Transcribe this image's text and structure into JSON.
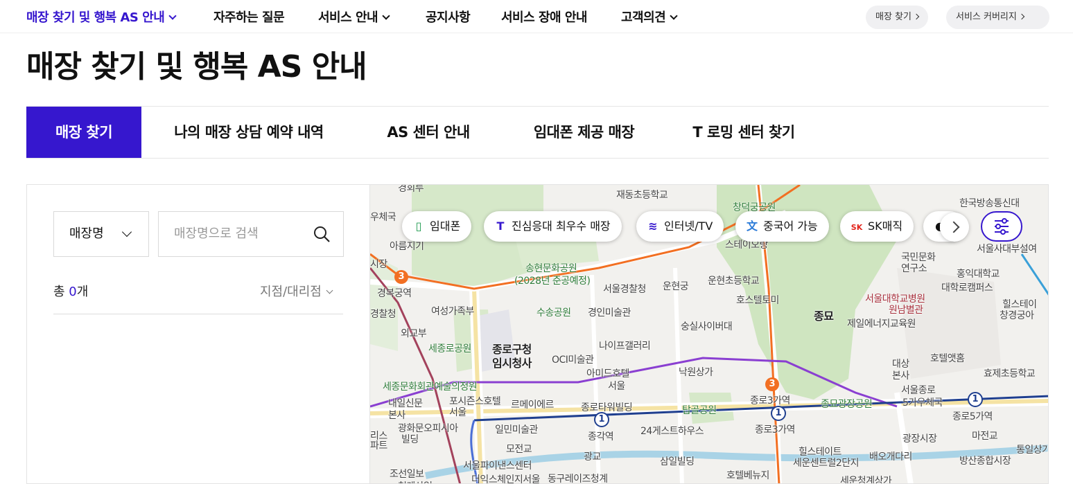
{
  "nav": {
    "items": [
      {
        "label": "매장 찾기 및 행복 AS 안내",
        "active": true,
        "has_dropdown": true
      },
      {
        "label": "자주하는 질문",
        "active": false,
        "has_dropdown": false
      },
      {
        "label": "서비스 안내",
        "active": false,
        "has_dropdown": true
      },
      {
        "label": "공지사항",
        "active": false,
        "has_dropdown": false
      },
      {
        "label": "서비스 장애 안내",
        "active": false,
        "has_dropdown": false
      },
      {
        "label": "고객의견",
        "active": false,
        "has_dropdown": true
      }
    ],
    "quick_links": [
      {
        "label": "매장 찾기"
      },
      {
        "label": "서비스 커버리지"
      }
    ]
  },
  "page_title": "매장 찾기 및 행복 AS 안내",
  "tabs": [
    {
      "label": "매장 찾기",
      "active": true
    },
    {
      "label": "나의 매장 상담 예약 내역",
      "active": false
    },
    {
      "label": "AS 센터 안내",
      "active": false
    },
    {
      "label": "임대폰 제공 매장",
      "active": false
    },
    {
      "label": "T 로밍 센터 찾기",
      "active": false
    }
  ],
  "search": {
    "select_value": "매장명",
    "placeholder": "매장명으로 검색"
  },
  "result": {
    "prefix": "총 ",
    "count": "0",
    "suffix": "개",
    "sort_label": "지점/대리점"
  },
  "map": {
    "chips": [
      {
        "label": "임대폰",
        "icon": "phone-icon"
      },
      {
        "label": "진심응대 최우수 매장",
        "icon": "t-logo-icon"
      },
      {
        "label": "인터넷/TV",
        "icon": "router-icon"
      },
      {
        "label": "중국어 가능",
        "icon": "chinese-char-icon"
      },
      {
        "label": "SK매직",
        "icon": "sk-logo-icon"
      }
    ],
    "labels": [
      {
        "text": "경회루",
        "cls": ""
      },
      {
        "text": "재동초등학교",
        "cls": ""
      },
      {
        "text": "창덕궁공원",
        "cls": "green"
      },
      {
        "text": "한국방송통신대",
        "cls": ""
      },
      {
        "text": "우체국",
        "cls": ""
      },
      {
        "text": "아름지기",
        "cls": ""
      },
      {
        "text": "시장",
        "cls": ""
      },
      {
        "text": "스테이오랑",
        "cls": ""
      },
      {
        "text": "송현문화공원",
        "cls": "green"
      },
      {
        "text": "(2028년 준공예정)",
        "cls": "green"
      },
      {
        "text": "서울경찰청",
        "cls": ""
      },
      {
        "text": "운현궁",
        "cls": ""
      },
      {
        "text": "운현초등학교",
        "cls": ""
      },
      {
        "text": "국민문화",
        "cls": ""
      },
      {
        "text": "연구소",
        "cls": ""
      },
      {
        "text": "홍익대학교",
        "cls": ""
      },
      {
        "text": "대학로캠퍼스",
        "cls": ""
      },
      {
        "text": "서울사대부설여",
        "cls": ""
      },
      {
        "text": "경복궁역",
        "cls": ""
      },
      {
        "text": "여성가족부",
        "cls": ""
      },
      {
        "text": "수송공원",
        "cls": "green"
      },
      {
        "text": "경인미술관",
        "cls": ""
      },
      {
        "text": "호스텔토미",
        "cls": ""
      },
      {
        "text": "종묘",
        "cls": "big"
      },
      {
        "text": "서울대학교병원",
        "cls": "red"
      },
      {
        "text": "원남별관",
        "cls": "red"
      },
      {
        "text": "힐스테이",
        "cls": ""
      },
      {
        "text": "창경궁아",
        "cls": ""
      },
      {
        "text": "경찰청",
        "cls": ""
      },
      {
        "text": "숭실사이버대",
        "cls": ""
      },
      {
        "text": "제일에너지교육원",
        "cls": ""
      },
      {
        "text": "외교부",
        "cls": ""
      },
      {
        "text": "세종로공원",
        "cls": "green"
      },
      {
        "text": "종로구청",
        "cls": "big"
      },
      {
        "text": "임시청사",
        "cls": "big"
      },
      {
        "text": "나이프갤러리",
        "cls": ""
      },
      {
        "text": "OCI미술관",
        "cls": ""
      },
      {
        "text": "아미드호텔",
        "cls": ""
      },
      {
        "text": "서울",
        "cls": ""
      },
      {
        "text": "낙원상가",
        "cls": ""
      },
      {
        "text": "대상",
        "cls": ""
      },
      {
        "text": "본사",
        "cls": ""
      },
      {
        "text": "호텔앳홈",
        "cls": ""
      },
      {
        "text": "효제초등학교",
        "cls": ""
      },
      {
        "text": "세종문화회관예술의정원",
        "cls": "green"
      },
      {
        "text": "내일신문",
        "cls": ""
      },
      {
        "text": "본사",
        "cls": ""
      },
      {
        "text": "포시즌스호텔",
        "cls": ""
      },
      {
        "text": "서울",
        "cls": ""
      },
      {
        "text": "르메이에르",
        "cls": ""
      },
      {
        "text": "종로타워빌딩",
        "cls": ""
      },
      {
        "text": "탑골공원",
        "cls": "green"
      },
      {
        "text": "종로3가역",
        "cls": ""
      },
      {
        "text": "종묘광장공원",
        "cls": "green"
      },
      {
        "text": "서울종로",
        "cls": ""
      },
      {
        "text": "5가우체국",
        "cls": ""
      },
      {
        "text": "종로5가역",
        "cls": ""
      },
      {
        "text": "광화문오피시아",
        "cls": ""
      },
      {
        "text": "빌딩",
        "cls": ""
      },
      {
        "text": "일민미술관",
        "cls": ""
      },
      {
        "text": "종각역",
        "cls": ""
      },
      {
        "text": "24게스트하우스",
        "cls": ""
      },
      {
        "text": "종로3가역",
        "cls": ""
      },
      {
        "text": "광장시장",
        "cls": ""
      },
      {
        "text": "마전교",
        "cls": ""
      },
      {
        "text": "통일상가",
        "cls": ""
      },
      {
        "text": "리스",
        "cls": ""
      },
      {
        "text": "파트",
        "cls": ""
      },
      {
        "text": "모전교",
        "cls": ""
      },
      {
        "text": "광교",
        "cls": ""
      },
      {
        "text": "힐스테이트",
        "cls": ""
      },
      {
        "text": "세운센트럴2단지",
        "cls": ""
      },
      {
        "text": "배오개다리",
        "cls": ""
      },
      {
        "text": "방산종합시장",
        "cls": ""
      },
      {
        "text": "조선일보",
        "cls": ""
      },
      {
        "text": "서울파이낸스센터",
        "cls": ""
      },
      {
        "text": "삼일빌딩",
        "cls": ""
      },
      {
        "text": "호텔베뉴지",
        "cls": ""
      },
      {
        "text": "세운청계상가",
        "cls": ""
      },
      {
        "text": "청계산업",
        "cls": ""
      },
      {
        "text": "더익스체인지서울",
        "cls": ""
      },
      {
        "text": "동구레이즈청계",
        "cls": ""
      }
    ],
    "subway_badges": [
      {
        "text": "3",
        "color": "#f26f22"
      },
      {
        "text": "3",
        "color": "#f26f22"
      },
      {
        "text": "1",
        "color": "#1f3f8f"
      },
      {
        "text": "1",
        "color": "#1f3f8f"
      },
      {
        "text": "1",
        "color": "#1f3f8f"
      }
    ]
  }
}
